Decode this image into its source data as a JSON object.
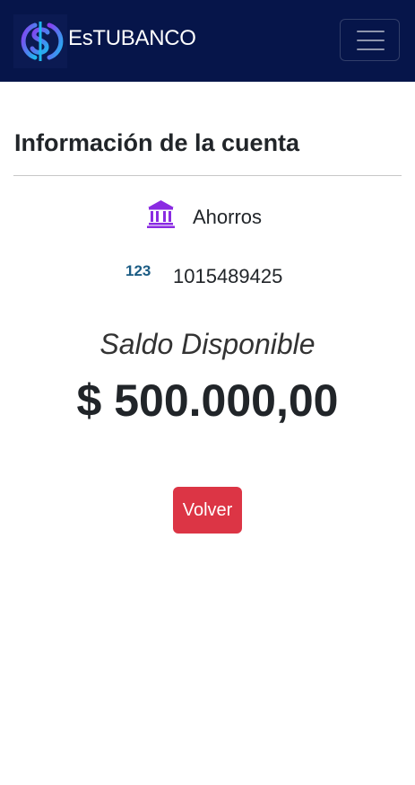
{
  "navbar": {
    "brand_name": "EsTUBANCO",
    "logo_icon": "dollar-s-logo-icon",
    "toggler_icon": "hamburger-menu-icon"
  },
  "account": {
    "title": "Información de la cuenta",
    "type_icon": "bank-icon",
    "type": "Ahorros",
    "number_icon_text": "123",
    "number": "1015489425"
  },
  "balance": {
    "label": "Saldo Disponible",
    "amount": "$ 500.000,00"
  },
  "actions": {
    "back_label": "Volver"
  },
  "colors": {
    "navbar_bg": "#06154a",
    "bank_icon": "#8a2be2",
    "numbers_icon": "#1b5c84",
    "danger": "#dc3545"
  }
}
